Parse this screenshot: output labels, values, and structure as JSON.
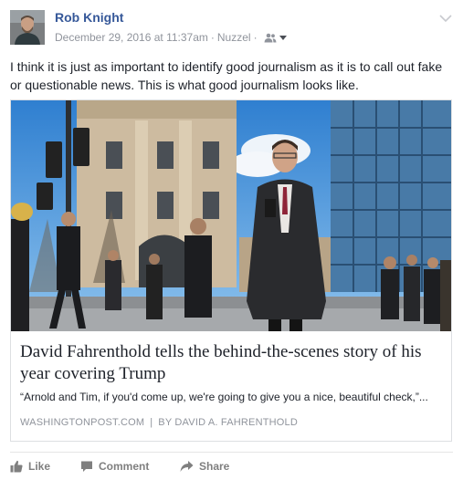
{
  "post": {
    "author": "Rob Knight",
    "timestamp": "December 29, 2016 at 11:37am",
    "separator": "·",
    "app": "Nuzzel",
    "audience_icon": "friends-icon",
    "text": "I think it is just as important to identify good journalism as it is to call out fake or questionable news. This is what good journalism looks like."
  },
  "link_card": {
    "title": "David Fahrenthold tells the behind-the-scenes story of his year covering Trump",
    "description": "“Arnold and Tim, if you'd come up, we're going to give you a nice, beautiful check,”...",
    "domain": "WASHINGTONPOST.COM",
    "separator": "|",
    "byline": "BY DAVID A. FAHRENTHOLD"
  },
  "actions": {
    "like": "Like",
    "comment": "Comment",
    "share": "Share"
  },
  "colors": {
    "author_link": "#365899",
    "meta_text": "#90949c",
    "action_text": "#7f7f7f",
    "card_border": "#dddfe2"
  }
}
